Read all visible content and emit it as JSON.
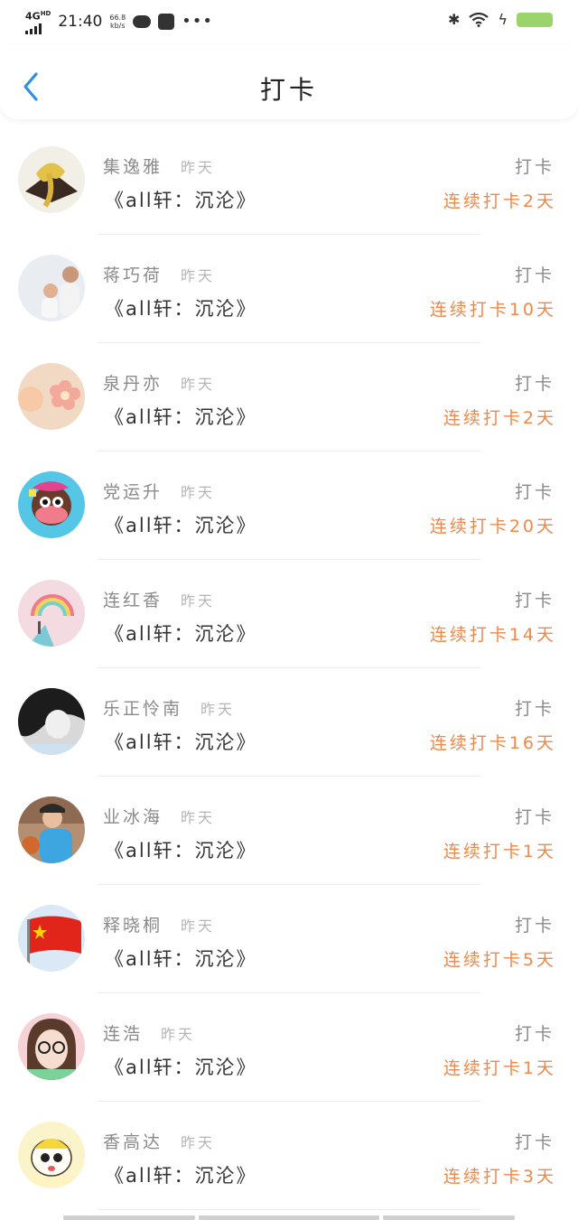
{
  "status_bar": {
    "network": "4G",
    "network_sup": "HD",
    "time": "21:40",
    "speed_value": "66.8",
    "speed_unit": "kb/s",
    "more": "•••",
    "colors": {
      "battery": "#9bd46a"
    },
    "icons": [
      "signal-icon",
      "cloud-icon",
      "bag-icon",
      "more-icon",
      "bluetooth-icon",
      "wifi-icon",
      "charging-icon",
      "battery-icon"
    ]
  },
  "header": {
    "title": "打卡",
    "accent": "#2f8fe6",
    "back_icon": "chevron-left-icon"
  },
  "colors": {
    "streak": "#f0884a",
    "muted": "#8a8a8a"
  },
  "checkins": [
    {
      "name": "集逸雅",
      "date": "昨天",
      "book": "《all轩：沉沦》",
      "action": "打卡",
      "streak": "连续打卡2天",
      "avatar": "gold-ribbon"
    },
    {
      "name": "蒋巧荷",
      "date": "昨天",
      "book": "《all轩：沉沦》",
      "action": "打卡",
      "streak": "连续打卡10天",
      "avatar": "father-child"
    },
    {
      "name": "泉丹亦",
      "date": "昨天",
      "book": "《all轩：沉沦》",
      "action": "打卡",
      "streak": "连续打卡2天",
      "avatar": "peach-flower"
    },
    {
      "name": "党运升",
      "date": "昨天",
      "book": "《all轩：沉沦》",
      "action": "打卡",
      "streak": "连续打卡20天",
      "avatar": "monkey"
    },
    {
      "name": "连红香",
      "date": "昨天",
      "book": "《all轩：沉沦》",
      "action": "打卡",
      "streak": "连续打卡14天",
      "avatar": "rainbow"
    },
    {
      "name": "乐正怜南",
      "date": "昨天",
      "book": "《all轩：沉沦》",
      "action": "打卡",
      "streak": "连续打卡16天",
      "avatar": "bw-portrait"
    },
    {
      "name": "业冰海",
      "date": "昨天",
      "book": "《all轩：沉沦》",
      "action": "打卡",
      "streak": "连续打卡1天",
      "avatar": "basketball"
    },
    {
      "name": "释晓桐",
      "date": "昨天",
      "book": "《all轩：沉沦》",
      "action": "打卡",
      "streak": "连续打卡5天",
      "avatar": "red-flag"
    },
    {
      "name": "连浩",
      "date": "昨天",
      "book": "《all轩：沉沦》",
      "action": "打卡",
      "streak": "连续打卡1天",
      "avatar": "girl-glasses"
    },
    {
      "name": "香高达",
      "date": "昨天",
      "book": "《all轩：沉沦》",
      "action": "打卡",
      "streak": "连续打卡3天",
      "avatar": "cartoon-face"
    }
  ]
}
